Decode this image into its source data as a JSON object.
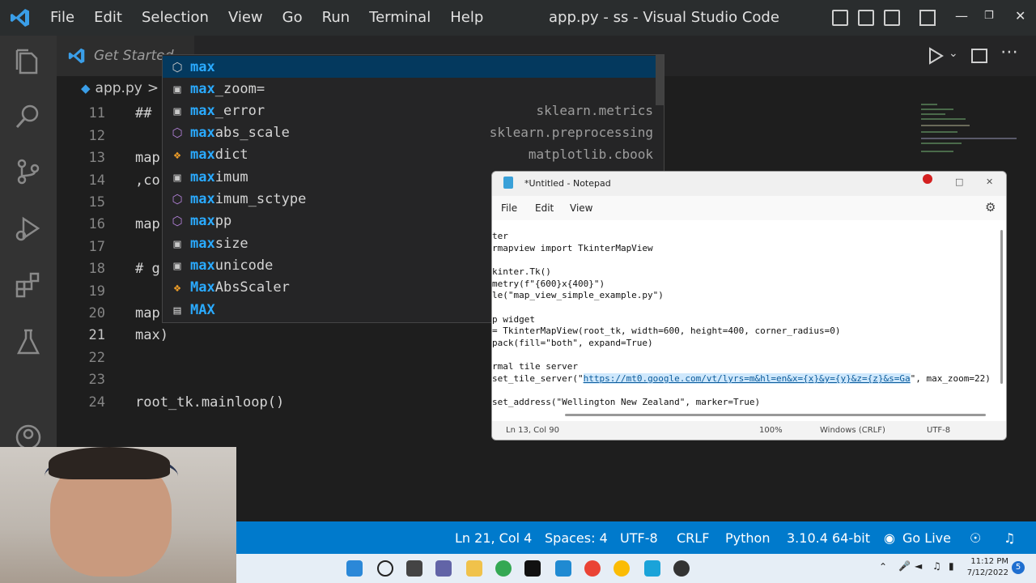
{
  "window": {
    "title": "app.py - ss - Visual Studio Code",
    "menu": [
      "File",
      "Edit",
      "Selection",
      "View",
      "Go",
      "Run",
      "Terminal",
      "Help"
    ]
  },
  "tabs": {
    "get_started": "Get Started"
  },
  "breadcrumb": {
    "file": "app.py",
    "separator": ">"
  },
  "editor": {
    "lines": [
      {
        "num": "11",
        "text": "##"
      },
      {
        "num": "12",
        "text": ""
      },
      {
        "num": "13",
        "text": "map"
      },
      {
        "num": "14",
        "text": ",co"
      },
      {
        "num": "15",
        "text": ""
      },
      {
        "num": "16",
        "text": "map"
      },
      {
        "num": "17",
        "text": ""
      },
      {
        "num": "18",
        "text": "# g"
      },
      {
        "num": "19",
        "text": ""
      },
      {
        "num": "20",
        "text": "map"
      },
      {
        "num": "21",
        "text": "max)"
      },
      {
        "num": "22",
        "text": ""
      },
      {
        "num": "23",
        "text": ""
      },
      {
        "num": "24",
        "text": "root_tk.mainloop()"
      }
    ]
  },
  "suggest": {
    "items": [
      {
        "match": "max",
        "rest": "",
        "kind": "module",
        "detail": ""
      },
      {
        "match": "max",
        "rest": "_zoom=",
        "kind": "variable",
        "detail": ""
      },
      {
        "match": "max",
        "rest": "_error",
        "kind": "variable",
        "detail": "sklearn.metrics"
      },
      {
        "match": "max",
        "rest": "abs_scale",
        "kind": "module",
        "detail": "sklearn.preprocessing"
      },
      {
        "match": "max",
        "rest": "dict",
        "kind": "class",
        "detail": "matplotlib.cbook"
      },
      {
        "match": "max",
        "rest": "imum",
        "kind": "variable",
        "detail": ""
      },
      {
        "match": "max",
        "rest": "imum_sctype",
        "kind": "module",
        "detail": ""
      },
      {
        "match": "max",
        "rest": "pp",
        "kind": "module",
        "detail": ""
      },
      {
        "match": "max",
        "rest": "size",
        "kind": "variable",
        "detail": ""
      },
      {
        "match": "max",
        "rest": "unicode",
        "kind": "variable",
        "detail": ""
      },
      {
        "match": "Max",
        "rest": "AbsScaler",
        "kind": "class",
        "detail": ""
      },
      {
        "match": "MAX",
        "rest": "",
        "kind": "text",
        "detail": ""
      }
    ]
  },
  "notepad": {
    "title": "*Untitled - Notepad",
    "menu": [
      "File",
      "Edit",
      "View"
    ],
    "lines": [
      "ter",
      "rmapview import TkinterMapView",
      "",
      "kinter.Tk()",
      "metry(f\"{600}x{400}\")",
      "le(\"map_view_simple_example.py\")",
      "",
      "p widget",
      "= TkinterMapView(root_tk, width=600, height=400, corner_radius=0)",
      "pack(fill=\"both\", expand=True)",
      "",
      "rmal tile server",
      "set_tile_server(\"",
      "",
      "set_address(\"Wellington New Zealand\", marker=True)"
    ],
    "url": "https://mt0.google.com/vt/lyrs=m&hl=en&x={x}&y={y}&z={z}&s=Ga",
    "url_suffix": "\", max_zoom=22)",
    "status": {
      "position": "Ln 13, Col 90",
      "zoom": "100%",
      "eol": "Windows (CRLF)",
      "encoding": "UTF-8"
    }
  },
  "statusbar": {
    "position": "Ln 21, Col 4",
    "spaces": "Spaces: 4",
    "encoding": "UTF-8",
    "eol": "CRLF",
    "language": "Python",
    "interpreter": "3.10.4 64-bit",
    "golive": "Go Live"
  },
  "taskbar": {
    "time": "11:12 PM",
    "date": "7/12/2022",
    "badge": "5"
  },
  "colors": {
    "accent": "#007acc",
    "suggest_highlight": "#2aaaff",
    "selected_row": "#04395e"
  }
}
